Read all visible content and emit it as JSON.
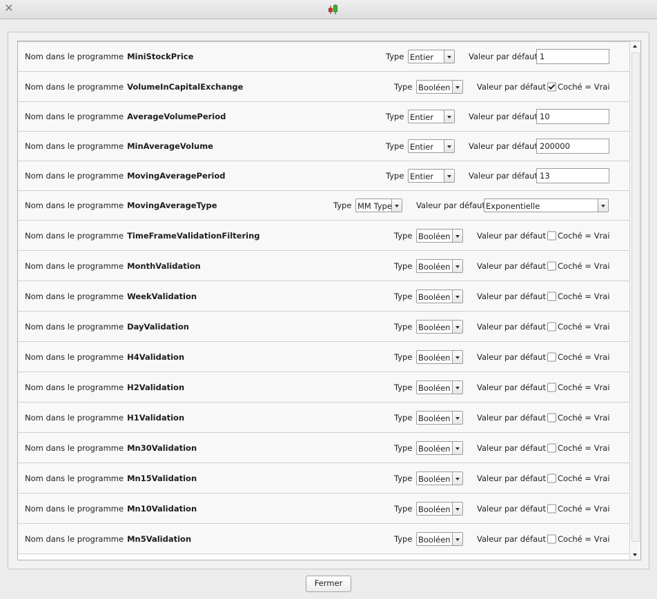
{
  "window": {
    "title": "",
    "close_icon": "close-icon",
    "app_icon": "candlestick-icon",
    "app_icon_colors": {
      "bear": "#e0302a",
      "bull": "#35b82a"
    }
  },
  "labels": {
    "name_prefix": "Nom dans le programme",
    "type": "Type",
    "default": "Valeur par défaut",
    "checked_true": "Coché = Vrai"
  },
  "rows": [
    {
      "name": "MiniStockPrice",
      "type": "Entier",
      "kind": "text",
      "value": "1"
    },
    {
      "name": "VolumeInCapitalExchange",
      "type": "Booléen",
      "kind": "bool",
      "checked": true
    },
    {
      "name": "AverageVolumePeriod",
      "type": "Entier",
      "kind": "text",
      "value": "10"
    },
    {
      "name": "MinAverageVolume",
      "type": "Entier",
      "kind": "text",
      "value": "200000"
    },
    {
      "name": "MovingAveragePeriod",
      "type": "Entier",
      "kind": "text",
      "value": "13"
    },
    {
      "name": "MovingAverageType",
      "type": "MM Type",
      "kind": "combo",
      "value": "Exponentielle"
    },
    {
      "name": "TimeFrameValidationFiltering",
      "type": "Booléen",
      "kind": "bool",
      "checked": false
    },
    {
      "name": "MonthValidation",
      "type": "Booléen",
      "kind": "bool",
      "checked": false
    },
    {
      "name": "WeekValidation",
      "type": "Booléen",
      "kind": "bool",
      "checked": false
    },
    {
      "name": "DayValidation",
      "type": "Booléen",
      "kind": "bool",
      "checked": false
    },
    {
      "name": "H4Validation",
      "type": "Booléen",
      "kind": "bool",
      "checked": false
    },
    {
      "name": "H2Validation",
      "type": "Booléen",
      "kind": "bool",
      "checked": false
    },
    {
      "name": "H1Validation",
      "type": "Booléen",
      "kind": "bool",
      "checked": false
    },
    {
      "name": "Mn30Validation",
      "type": "Booléen",
      "kind": "bool",
      "checked": false
    },
    {
      "name": "Mn15Validation",
      "type": "Booléen",
      "kind": "bool",
      "checked": false
    },
    {
      "name": "Mn10Validation",
      "type": "Booléen",
      "kind": "bool",
      "checked": false
    },
    {
      "name": "Mn5Validation",
      "type": "Booléen",
      "kind": "bool",
      "checked": false
    }
  ],
  "footer": {
    "close_label": "Fermer"
  }
}
